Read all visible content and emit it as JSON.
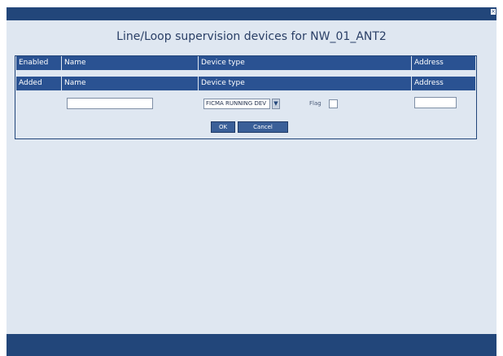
{
  "dialog": {
    "title": "Line/Loop supervision devices for NW_01_ANT2",
    "close_icon": "close-icon"
  },
  "table": {
    "header_rows": [
      [
        "Enabled",
        "Name",
        "Device type",
        "Address"
      ],
      [
        "Added",
        "Name",
        "Device type",
        "Address"
      ]
    ],
    "inputs": {
      "name_value": "",
      "device_type_selected": "FICMA RUNNING DEV",
      "flag_label": "Flag",
      "address_value": ""
    }
  },
  "buttons": {
    "ok": "OK",
    "cancel": "Cancel"
  }
}
